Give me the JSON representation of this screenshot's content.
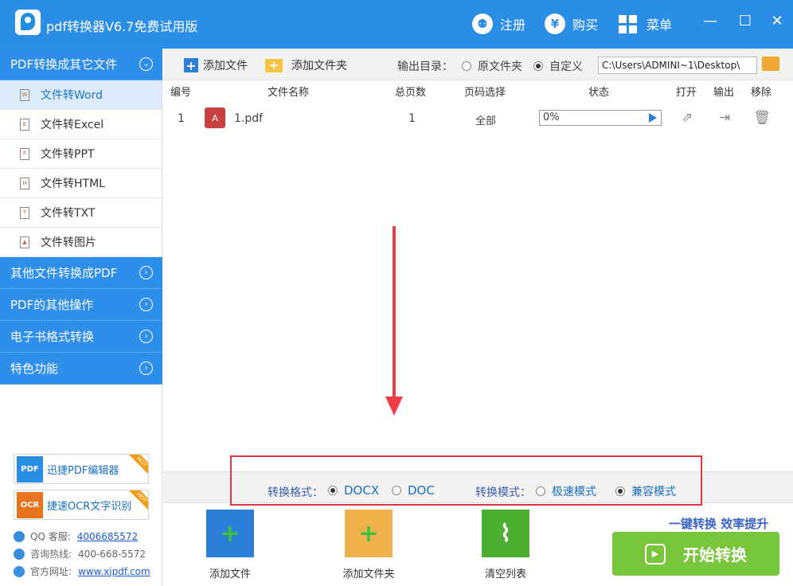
{
  "app": {
    "title": "pdf转换器V6.7免费试用版"
  },
  "titlebar": {
    "register": "注册",
    "buy": "购买",
    "menu": "菜单",
    "minimize": "—",
    "maximize": "☐",
    "close": "✕"
  },
  "sidebar": {
    "cat1": "PDF转换成其它文件",
    "items": [
      {
        "label": "文件转Word",
        "icon": "W"
      },
      {
        "label": "文件转Excel",
        "icon": "E"
      },
      {
        "label": "文件转PPT",
        "icon": "P"
      },
      {
        "label": "文件转HTML",
        "icon": "H"
      },
      {
        "label": "文件转TXT",
        "icon": "T"
      },
      {
        "label": "文件转图片",
        "icon": "▲"
      }
    ],
    "cat2": "其他文件转换成PDF",
    "cat3": "PDF的其他操作",
    "cat4": "电子书格式转换",
    "cat5": "特色功能",
    "promo1": {
      "label": "迅捷PDF编辑器",
      "badge": "HOT",
      "icon": "PDF"
    },
    "promo2": {
      "label": "捷速OCR文字识别",
      "badge": "HOT",
      "icon": "OCR"
    },
    "qq_label": "QQ 客服:",
    "qq_value": "4006685572",
    "hotline_label": "咨询热线:",
    "hotline_value": "400-668-5572",
    "site_label": "官方网址:",
    "site_value": "www.xjpdf.com"
  },
  "toolbar": {
    "add_file": "添加文件",
    "add_folder": "添加文件夹",
    "output_dir_label": "输出目录：",
    "opt_original": "原文件夹",
    "opt_custom": "自定义",
    "path": "C:\\Users\\ADMINI~1\\Desktop\\"
  },
  "table": {
    "headers": {
      "num": "编号",
      "name": "文件名称",
      "pages": "总页数",
      "range": "页码选择",
      "status": "状态",
      "open": "打开",
      "output": "输出",
      "remove": "移除"
    },
    "rows": [
      {
        "num": "1",
        "name": "1.pdf",
        "pages": "1",
        "range": "全部",
        "progress": "0%"
      }
    ]
  },
  "options": {
    "format_label": "转换格式：",
    "fmt_docx": "DOCX",
    "fmt_doc": "DOC",
    "mode_label": "转换模式：",
    "mode_fast": "极速模式",
    "mode_compat": "兼容模式"
  },
  "bottom": {
    "add_file": "添加文件",
    "add_folder": "添加文件夹",
    "clear_list": "清空列表",
    "slogan": "一键转换  效率提升",
    "start": "开始转换"
  },
  "colors": {
    "brand": "#2b8ee6",
    "start": "#78c63c",
    "annotation": "#e3353f"
  }
}
